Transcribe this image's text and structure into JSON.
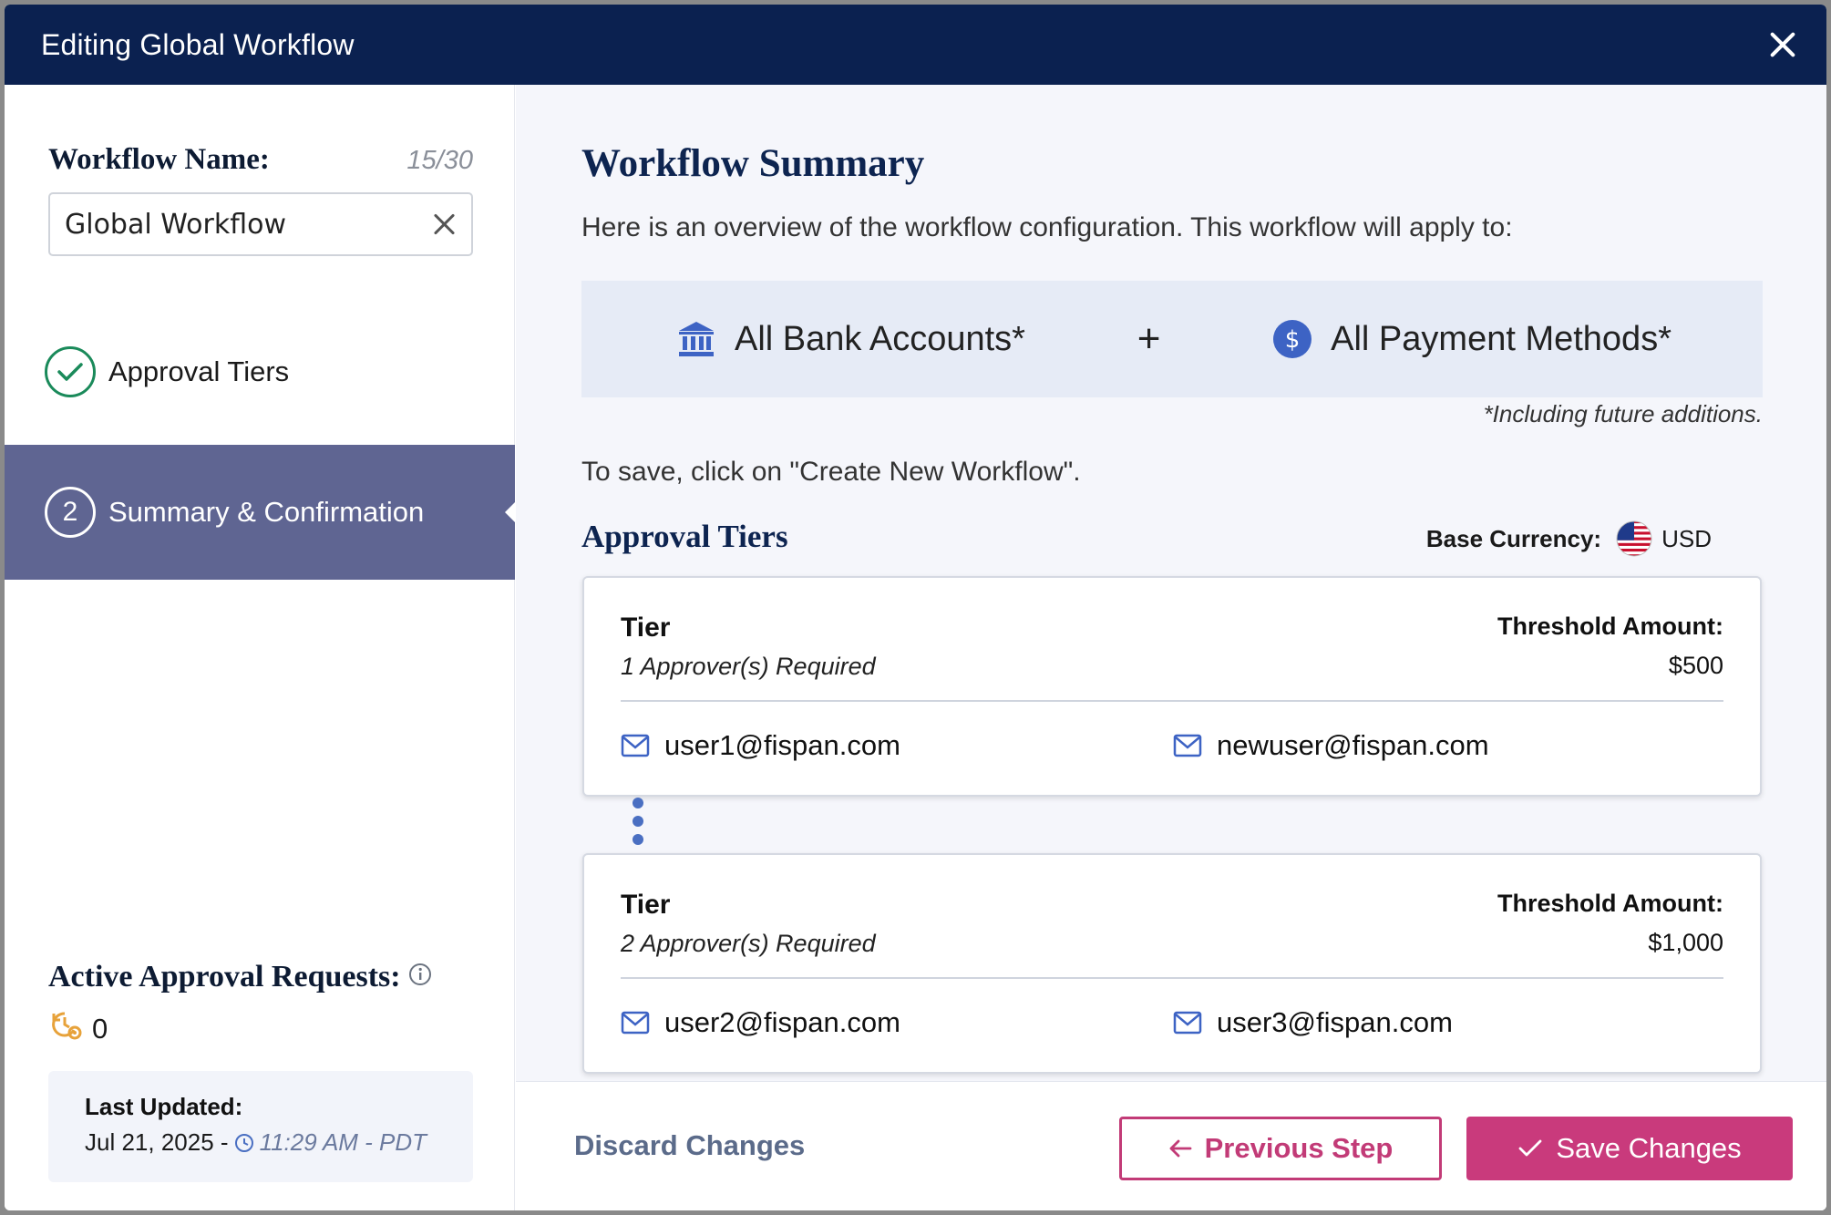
{
  "header": {
    "title": "Editing Global Workflow",
    "close_icon": "close-icon"
  },
  "sidebar": {
    "workflow_name_label": "Workflow Name:",
    "workflow_name_count": "15/30",
    "workflow_name_value": "Global Workflow",
    "steps": [
      {
        "number": "",
        "label": "Approval Tiers",
        "status": "complete"
      },
      {
        "number": "2",
        "label": "Summary & Confirmation",
        "status": "active"
      }
    ],
    "active_requests_label": "Active Approval Requests:",
    "active_requests_count": "0",
    "last_updated_label": "Last Updated:",
    "last_updated_date": "Jul 21, 2025 -",
    "last_updated_time": "11:29 AM - PDT"
  },
  "main": {
    "title": "Workflow Summary",
    "description": "Here is an overview of the workflow configuration. This workflow will apply to:",
    "scope": {
      "bank_accounts": "All Bank Accounts*",
      "plus": "+",
      "payment_methods": "All Payment Methods*"
    },
    "scope_note": "*Including future additions.",
    "save_note": "To save, click on \"Create New Workflow\".",
    "tiers_title": "Approval Tiers",
    "base_currency_label": "Base Currency:",
    "base_currency_value": "USD",
    "tiers": [
      {
        "name": "Tier",
        "requirement": "1 Approver(s) Required",
        "threshold_label": "Threshold Amount:",
        "threshold_value": "$500",
        "approvers": [
          "user1@fispan.com",
          "newuser@fispan.com"
        ]
      },
      {
        "name": "Tier",
        "requirement": "2 Approver(s) Required",
        "threshold_label": "Threshold Amount:",
        "threshold_value": "$1,000",
        "approvers": [
          "user2@fispan.com",
          "user3@fispan.com"
        ]
      }
    ]
  },
  "footer": {
    "discard_label": "Discard Changes",
    "previous_label": "Previous Step",
    "save_label": "Save Changes"
  },
  "colors": {
    "header_bg": "#0b2150",
    "active_step_bg": "#5f6592",
    "accent_pink": "#c93a7c",
    "complete_green": "#1a8a5a",
    "scope_bg": "#e6ebf6"
  }
}
